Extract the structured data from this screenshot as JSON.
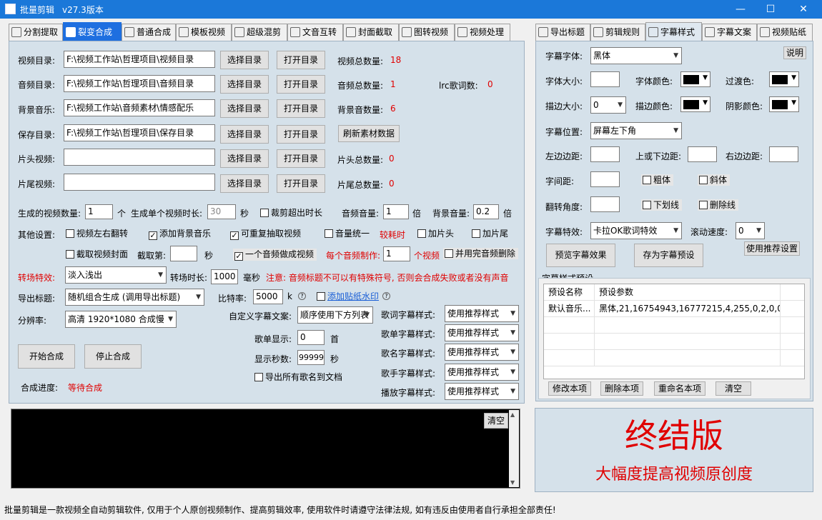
{
  "window": {
    "title": "批量剪辑",
    "version": "v27.3版本",
    "minimize": "—",
    "maximize": "☐",
    "close": "✕"
  },
  "left_tabs": [
    {
      "label": "分割提取"
    },
    {
      "label": "裂变合成"
    },
    {
      "label": "普通合成"
    },
    {
      "label": "模板视频"
    },
    {
      "label": "超级混剪"
    },
    {
      "label": "文音互转"
    },
    {
      "label": "封面截取"
    },
    {
      "label": "图转视频"
    },
    {
      "label": "视频处理"
    }
  ],
  "right_tabs": [
    {
      "label": "导出标题"
    },
    {
      "label": "剪辑规则"
    },
    {
      "label": "字幕样式"
    },
    {
      "label": "字幕文案"
    },
    {
      "label": "视频贴纸"
    }
  ],
  "dirs": [
    {
      "label": "视频目录:",
      "value": "F:\\视频工作站\\哲理项目\\视频目录",
      "btn1": "选择目录",
      "btn2": "打开目录",
      "stat_label": "视频总数量:",
      "stat_value": "18"
    },
    {
      "label": "音频目录:",
      "value": "F:\\视频工作站\\哲理项目\\音频目录",
      "btn1": "选择目录",
      "btn2": "打开目录",
      "stat_label": "音频总数量:",
      "stat_value": "1",
      "extra_label": "lrc歌词数:",
      "extra_value": "0"
    },
    {
      "label": "背景音乐:",
      "value": "F:\\视频工作站\\音频素材\\情感配乐",
      "btn1": "选择目录",
      "btn2": "打开目录",
      "stat_label": "背景音数量:",
      "stat_value": "6"
    },
    {
      "label": "保存目录:",
      "value": "F:\\视频工作站\\哲理项目\\保存目录",
      "btn1": "选择目录",
      "btn2": "打开目录",
      "refresh": "刷新素材数据"
    },
    {
      "label": "片头视频:",
      "value": "",
      "btn1": "选择目录",
      "btn2": "打开目录",
      "stat_label": "片头总数量:",
      "stat_value": "0"
    },
    {
      "label": "片尾视频:",
      "value": "",
      "btn1": "选择目录",
      "btn2": "打开目录",
      "stat_label": "片尾总数量:",
      "stat_value": "0"
    }
  ],
  "gen": {
    "count_label": "生成的视频数量:",
    "count_value": "1",
    "count_unit": "个",
    "dur_label": "生成单个视频时长:",
    "dur_value": "30",
    "dur_unit": "秒",
    "trim_label": "裁剪超出时长",
    "vol_label": "音频音量:",
    "vol_value": "1",
    "vol_unit": "倍",
    "bgvol_label": "背景音量:",
    "bgvol_value": "0.2",
    "bgvol_unit": "倍"
  },
  "other": {
    "label": "其他设置:",
    "flip": "视频左右翻转",
    "add_bg": "添加背景音乐",
    "repeat": "可重复抽取视频",
    "vol_unify": "音量统一",
    "slow": "较耗时",
    "add_head": "加片头",
    "add_tail": "加片尾",
    "cover": "截取视频封面",
    "cover_at": "截取第:",
    "cover_unit": "秒",
    "one_audio": "一个音频做成视频",
    "per_audio": "每个音频制作:",
    "per_value": "1",
    "per_unit": "个视频",
    "delete_audio": "并用完音频删除"
  },
  "transition": {
    "label": "转场特效:",
    "value": "淡入浅出",
    "dur_label": "转场时长:",
    "dur_value": "1000",
    "dur_unit": "毫秒",
    "notice": "注意: 音频标题不可以有特殊符号, 否则会合成失败或者没有声音"
  },
  "export": {
    "label": "导出标题:",
    "value": "随机组合生成 (调用导出标题)",
    "bitrate_label": "比特率:",
    "bitrate_value": "5000",
    "bitrate_unit": "k",
    "watermark": "添加贴纸水印"
  },
  "resolution": {
    "label": "分辨率:",
    "value": "高清 1920*1080 合成慢"
  },
  "subtitle_copy": {
    "label": "自定义字幕文案:",
    "value": "顺序使用下方列表"
  },
  "playlist": {
    "show_label": "歌单显示:",
    "show_value": "0",
    "show_unit": "首",
    "sec_label": "显示秒数:",
    "sec_value": "99999",
    "sec_unit": "秒",
    "export_all": "导出所有歌名到文档"
  },
  "styles": [
    {
      "label": "歌词字幕样式:",
      "value": "使用推荐样式"
    },
    {
      "label": "歌单字幕样式:",
      "value": "使用推荐样式"
    },
    {
      "label": "歌名字幕样式:",
      "value": "使用推荐样式"
    },
    {
      "label": "歌手字幕样式:",
      "value": "使用推荐样式"
    },
    {
      "label": "播放字幕样式:",
      "value": "使用推荐样式"
    }
  ],
  "actions": {
    "start": "开始合成",
    "stop": "停止合成",
    "progress_label": "合成进度:",
    "progress_value": "等待合成"
  },
  "console": {
    "clear": "清空"
  },
  "sub": {
    "font_label": "字幕字体:",
    "font_value": "黑体",
    "help": "说明",
    "size_label": "字体大小:",
    "size_value": "",
    "color_label": "字体颜色:",
    "trans_label": "过渡色:",
    "stroke_label": "描边大小:",
    "stroke_value": "0",
    "stroke_color_label": "描边颜色:",
    "shadow_label": "阴影颜色:",
    "pos_label": "字幕位置:",
    "pos_value": "屏幕左下角",
    "lmargin": "左边边距:",
    "vmargin": "上或下边距:",
    "rmargin": "右边边距:",
    "spacing": "字间距:",
    "bold": "粗体",
    "italic": "斜体",
    "angle": "翻转角度:",
    "underline": "下划线",
    "strike": "删除线",
    "effect_label": "字幕特效:",
    "effect_value": "卡拉OK歌词特效",
    "scroll_label": "滚动速度:",
    "scroll_value": "0",
    "preview": "预览字幕效果",
    "save_preset": "存为字幕预设",
    "use_rec": "使用推荐设置",
    "preset_title": "字幕样式预设",
    "preset_cols": [
      "预设名称",
      "预设参数"
    ],
    "preset_rows": [
      [
        "默认音乐...",
        "黑体,21,16754943,16777215,4,255,0,2,0,0,..."
      ]
    ],
    "edit": "修改本项",
    "delete": "删除本项",
    "rename": "重命名本项",
    "clear": "清空"
  },
  "promo": {
    "line1": "终结版",
    "line2": "大幅度提高视频原创度"
  },
  "status": "批量剪辑是一款视频全自动剪辑软件, 仅用于个人原创视频制作、提高剪辑效率, 使用软件时请遵守法律法规, 如有违反由使用者自行承担全部责任!",
  "colors": {
    "titlebar": "#1b78d9",
    "accent_red": "#e00000",
    "panel": "#d5e1ea",
    "tab_active": "#1e6fe0"
  }
}
